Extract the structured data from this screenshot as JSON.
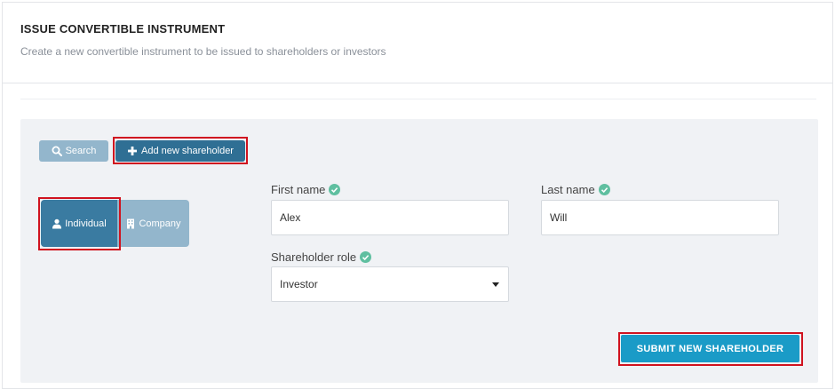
{
  "header": {
    "title": "ISSUE CONVERTIBLE INSTRUMENT",
    "subtitle": "Create a new convertible instrument to be issued to shareholders or investors"
  },
  "toolbar": {
    "search_label": "Search",
    "add_label": "Add new shareholder"
  },
  "type_toggle": {
    "individual_label": "Individual",
    "company_label": "Company",
    "selected": "Individual"
  },
  "form": {
    "first_name": {
      "label": "First name",
      "value": "Alex"
    },
    "last_name": {
      "label": "Last name",
      "value": "Will"
    },
    "role": {
      "label": "Shareholder role",
      "value": "Investor"
    }
  },
  "submit_label": "SUBMIT NEW SHAREHOLDER",
  "colors": {
    "primary": "#2f6f94",
    "light": "#93b6cc",
    "accent": "#1a9bc7",
    "check": "#5fbfa0",
    "highlight": "#d0131f"
  }
}
